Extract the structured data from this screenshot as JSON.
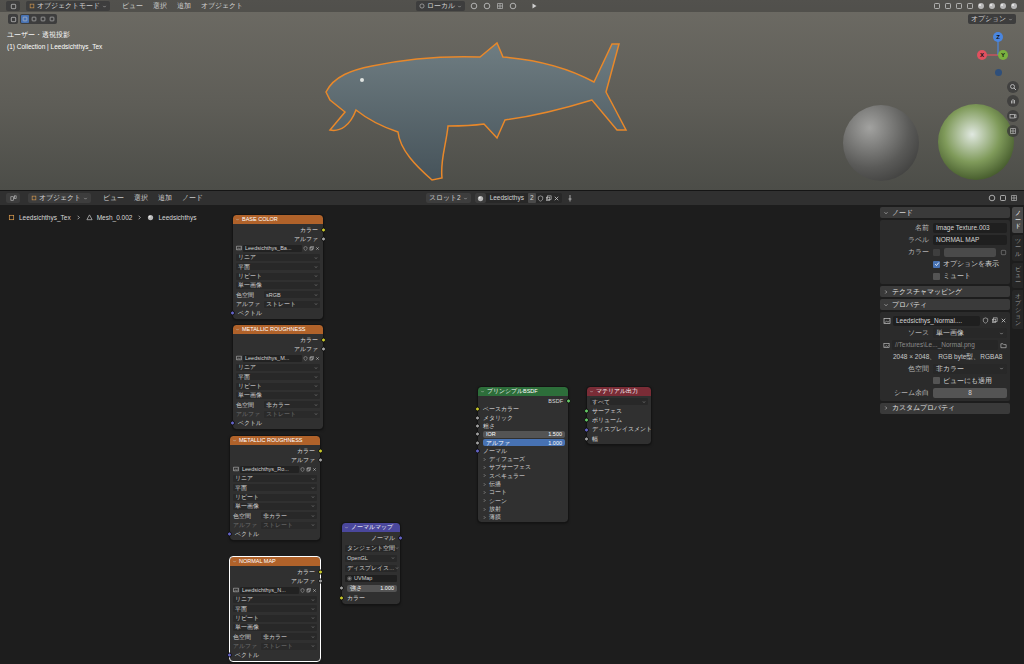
{
  "topbar": {
    "mode": "オブジェクトモード",
    "menus": [
      "ビュー",
      "選択",
      "追加",
      "オブジェクト"
    ],
    "transform": "ローカル",
    "options": "オプション"
  },
  "viewport": {
    "view": "ユーザー・透視投影",
    "collection": "(1) Collection | Leedsichthys_Tex",
    "gizmo": [
      {
        "label": "X",
        "color": "#e0505f"
      },
      {
        "label": "Y",
        "color": "#7ab03f"
      },
      {
        "label": "Z",
        "color": "#4a86e0"
      }
    ]
  },
  "node_header": {
    "mode": "オブジェクト",
    "menus": [
      "ビュー",
      "選択",
      "追加",
      "ノード"
    ],
    "slot": "スロット2",
    "material": "Leedsicthys",
    "users": "2"
  },
  "breadcrumb": [
    "Leedsichthys_Tex",
    "Mesh_0.002",
    "Leedsichthys"
  ],
  "nodes": [
    {
      "title": "BASE COLOR",
      "color": "#b0622a",
      "selected": false,
      "rows": [
        {
          "kind": "out",
          "text": "カラー",
          "color": "#c7c729"
        },
        {
          "kind": "out",
          "text": "アルファ",
          "color": "#a1a1a1"
        },
        {
          "kind": "image",
          "text": "Leedsichthys_Ba..."
        },
        {
          "kind": "select",
          "text": "リニア"
        },
        {
          "kind": "select",
          "text": "平面"
        },
        {
          "kind": "select",
          "text": "リピート"
        },
        {
          "kind": "select",
          "text": "単一画像"
        },
        {
          "kind": "prop",
          "label": "色空間",
          "text": "sRGB",
          "disabled": false
        },
        {
          "kind": "prop",
          "label": "アルファ",
          "text": "ストレート",
          "disabled": false
        },
        {
          "kind": "in",
          "text": "ベクトル",
          "color": "#6363c7"
        }
      ]
    },
    {
      "title": "METALLIC ROUGHNESS",
      "color": "#b0622a",
      "selected": false,
      "rows": [
        {
          "kind": "out",
          "text": "カラー",
          "color": "#c7c729"
        },
        {
          "kind": "out",
          "text": "アルファ",
          "color": "#a1a1a1"
        },
        {
          "kind": "image",
          "text": "Leedsichthys_M..."
        },
        {
          "kind": "select",
          "text": "リニア"
        },
        {
          "kind": "select",
          "text": "平面"
        },
        {
          "kind": "select",
          "text": "リピート"
        },
        {
          "kind": "select",
          "text": "単一画像"
        },
        {
          "kind": "prop",
          "label": "色空間",
          "text": "非カラー",
          "disabled": false
        },
        {
          "kind": "prop",
          "label": "アルファ",
          "text": "ストレート",
          "disabled": true
        },
        {
          "kind": "in",
          "text": "ベクトル",
          "color": "#6363c7"
        }
      ]
    },
    {
      "title": "METALLIC ROUGHNESS",
      "color": "#b0622a",
      "selected": false,
      "rows": [
        {
          "kind": "out",
          "text": "カラー",
          "color": "#c7c729"
        },
        {
          "kind": "out",
          "text": "アルファ",
          "color": "#a1a1a1"
        },
        {
          "kind": "image",
          "text": "Leedsichthys_Ro..."
        },
        {
          "kind": "select",
          "text": "リニア"
        },
        {
          "kind": "select",
          "text": "平面"
        },
        {
          "kind": "select",
          "text": "リピート"
        },
        {
          "kind": "select",
          "text": "単一画像"
        },
        {
          "kind": "prop",
          "label": "色空間",
          "text": "非カラー",
          "disabled": false
        },
        {
          "kind": "prop",
          "label": "アルファ",
          "text": "ストレート",
          "disabled": true
        },
        {
          "kind": "in",
          "text": "ベクトル",
          "color": "#6363c7"
        }
      ]
    },
    {
      "title": "NORMAL MAP",
      "color": "#b0622a",
      "selected": true,
      "rows": [
        {
          "kind": "out",
          "text": "カラー",
          "color": "#c7c729"
        },
        {
          "kind": "out",
          "text": "アルファ",
          "color": "#a1a1a1"
        },
        {
          "kind": "image",
          "text": "Leedsichthys_N..."
        },
        {
          "kind": "select",
          "text": "リニア"
        },
        {
          "kind": "select",
          "text": "平面"
        },
        {
          "kind": "select",
          "text": "リピート"
        },
        {
          "kind": "select",
          "text": "単一画像"
        },
        {
          "kind": "prop",
          "label": "色空間",
          "text": "非カラー",
          "disabled": false
        },
        {
          "kind": "prop",
          "label": "アルファ",
          "text": "ストレート",
          "disabled": true
        },
        {
          "kind": "in",
          "text": "ベクトル",
          "color": "#6363c7"
        }
      ]
    },
    {
      "title": "ノーマルマップ",
      "color": "#4a479c",
      "selected": false,
      "rows": [
        {
          "kind": "out",
          "text": "ノーマル",
          "color": "#6363c7"
        },
        {
          "kind": "select",
          "text": "タンジェント空間"
        },
        {
          "kind": "select",
          "text": "OpenGL"
        },
        {
          "kind": "select",
          "text": "ディスプレイス…"
        },
        {
          "kind": "uv",
          "text": "UVMap"
        },
        {
          "kind": "value",
          "label": "強さ",
          "text": "1.000",
          "color": "#a1a1a1",
          "highlight": false
        },
        {
          "kind": "in",
          "text": "カラー",
          "color": "#c7c729"
        }
      ]
    },
    {
      "title": "プリンシプルBSDF",
      "color": "#2d6e3a",
      "selected": false,
      "rows": [
        {
          "kind": "out",
          "text": "BSDF",
          "color": "#63c763"
        },
        {
          "kind": "in",
          "text": "ベースカラー",
          "color": "#c7c729"
        },
        {
          "kind": "in",
          "text": "メタリック",
          "color": "#a1a1a1"
        },
        {
          "kind": "in",
          "text": "粗さ",
          "color": "#a1a1a1"
        },
        {
          "kind": "value",
          "label": "IOR",
          "text": "1.500",
          "color": "#a1a1a1",
          "highlight": false
        },
        {
          "kind": "value",
          "label": "アルファ",
          "text": "1.000",
          "color": "#a1a1a1",
          "highlight": true
        },
        {
          "kind": "in",
          "text": "ノーマル",
          "color": "#6363c7"
        },
        {
          "kind": "panel",
          "text": "ディフューズ",
          "expanded": false
        },
        {
          "kind": "panel",
          "text": "サブサーフェス",
          "expanded": false
        },
        {
          "kind": "panel",
          "text": "スペキュラー",
          "expanded": false
        },
        {
          "kind": "panel",
          "text": "伝播",
          "expanded": false
        },
        {
          "kind": "panel",
          "text": "コート",
          "expanded": false
        },
        {
          "kind": "panel",
          "text": "シーン",
          "expanded": false
        },
        {
          "kind": "panel",
          "text": "放射",
          "expanded": false
        },
        {
          "kind": "panel",
          "text": "薄膜",
          "expanded": false
        }
      ]
    },
    {
      "title": "マテリアル出力",
      "color": "#7a2c36",
      "selected": false,
      "rows": [
        {
          "kind": "select",
          "text": "すべて"
        },
        {
          "kind": "in",
          "text": "サーフェス",
          "color": "#63c763"
        },
        {
          "kind": "in",
          "text": "ボリューム",
          "color": "#63c763"
        },
        {
          "kind": "in",
          "text": "ディスプレイスメント",
          "color": "#6363c7"
        },
        {
          "kind": "in",
          "text": "幅",
          "color": "#a1a1a1"
        }
      ]
    }
  ],
  "links": [
    {
      "from": [
        0,
        0
      ],
      "to": [
        5,
        1
      ],
      "color": "#c7c729"
    },
    {
      "from": [
        1,
        0
      ],
      "to": [
        5,
        2
      ],
      "color": "#b5b58a"
    },
    {
      "from": [
        2,
        0
      ],
      "to": [
        5,
        3
      ],
      "color": "#c7c729"
    },
    {
      "from": [
        3,
        0
      ],
      "to": [
        4,
        6
      ],
      "color": "#c7c729"
    },
    {
      "from": [
        4,
        0
      ],
      "to": [
        5,
        6
      ],
      "color": "#6363c7"
    },
    {
      "from": [
        5,
        0
      ],
      "to": [
        6,
        1
      ],
      "color": "#63c763"
    }
  ],
  "sidebar": {
    "node_panel": {
      "title": "ノード",
      "expanded": true,
      "name_label": "名前",
      "name": "Image Texture.003",
      "label_label": "ラベル",
      "label": "NORMAL MAP",
      "color_label": "カラー",
      "color_enabled": false,
      "show_options": {
        "label": "オプションを表示",
        "checked": true
      },
      "mute": {
        "label": "ミュート",
        "checked": false
      }
    },
    "texture_mapping": {
      "title": "テクスチャマッピング",
      "expanded": false
    },
    "properties": {
      "title": "プロパティ",
      "expanded": true,
      "image": "Leedsicthys_Normal....",
      "source_label": "ソース",
      "source": "単一画像",
      "filepath": "//Textures\\Le..._Normal.png",
      "info": "2048 × 2048、 RGB byte型、RGBA8",
      "colorspace_label": "色空間",
      "colorspace": "非カラー",
      "view_as_render": {
        "label": "ビューにも適用",
        "checked": false
      },
      "seam_label": "シーム余白",
      "seam": "8"
    },
    "custom_properties": {
      "title": "カスタムプロパティ",
      "expanded": false
    }
  },
  "sidebar_tabs": [
    {
      "label": "ノード",
      "selected": true
    },
    {
      "label": "ツール",
      "selected": false
    },
    {
      "label": "ビュー",
      "selected": false
    },
    {
      "label": "オプション",
      "selected": false
    }
  ]
}
